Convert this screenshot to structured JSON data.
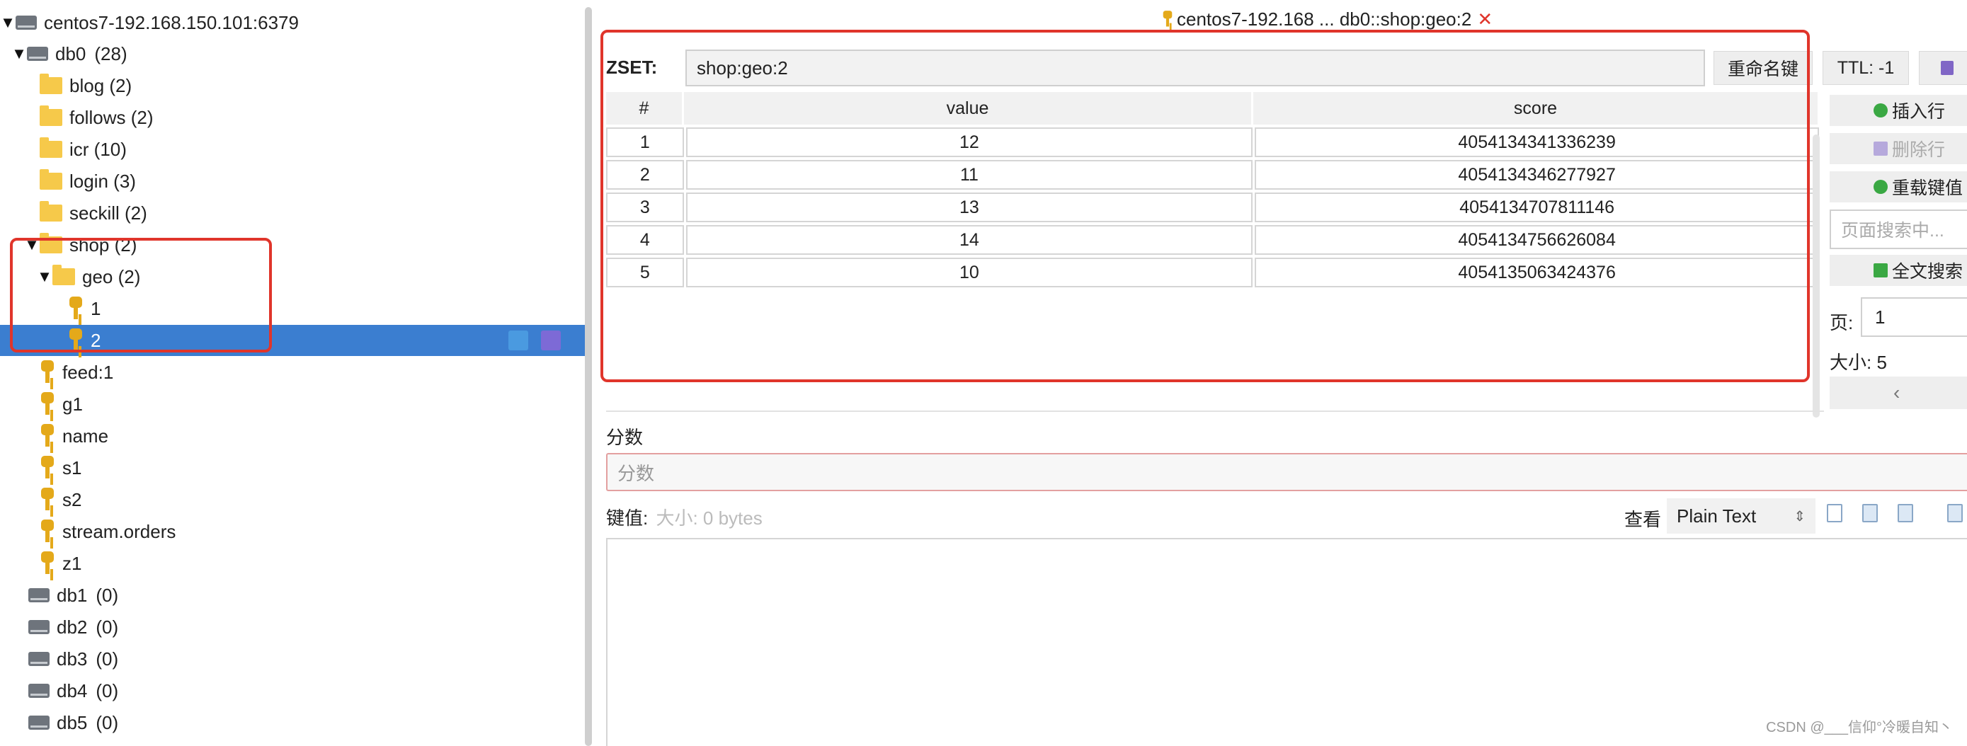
{
  "tree": {
    "connection": "centos7-192.168.150.101:6379",
    "db0": {
      "name": "db0",
      "count": "(28)"
    },
    "folders": [
      {
        "label": "blog (2)"
      },
      {
        "label": "follows (2)"
      },
      {
        "label": "icr (10)"
      },
      {
        "label": "login (3)"
      },
      {
        "label": "seckill (2)"
      },
      {
        "label": "shop (2)"
      }
    ],
    "geo_folder": "geo (2)",
    "geo_keys": [
      "1",
      "2"
    ],
    "keys": [
      "feed:1",
      "g1",
      "name",
      "s1",
      "s2",
      "stream.orders",
      "z1"
    ],
    "dbs": [
      {
        "name": "db1",
        "count": "(0)"
      },
      {
        "name": "db2",
        "count": "(0)"
      },
      {
        "name": "db3",
        "count": "(0)"
      },
      {
        "name": "db4",
        "count": "(0)"
      },
      {
        "name": "db5",
        "count": "(0)"
      }
    ],
    "selected_key": "2"
  },
  "tab": {
    "title": "centos7-192.168 ... db0::shop:geo:2",
    "close": "✕"
  },
  "key_header": {
    "type_label": "ZSET:",
    "key_name": "shop:geo:2",
    "rename_label": "重命名键",
    "ttl_label": "TTL:  -1"
  },
  "table": {
    "headers": [
      "#",
      "value",
      "score"
    ],
    "rows": [
      {
        "num": "1",
        "value": "12",
        "score": "4054134341336239"
      },
      {
        "num": "2",
        "value": "11",
        "score": "4054134346277927"
      },
      {
        "num": "3",
        "value": "13",
        "score": "4054134707811146"
      },
      {
        "num": "4",
        "value": "14",
        "score": "4054134756626084"
      },
      {
        "num": "5",
        "value": "10",
        "score": "4054135063424376"
      }
    ]
  },
  "side": {
    "insert_label": "插入行",
    "delete_label": "删除行",
    "reload_label": "重载键值",
    "search_placeholder": "页面搜索中...",
    "fulltext_label": "全文搜索",
    "page_label": "页:",
    "page_value": "1",
    "size_line": "大小:  5",
    "prev": "‹"
  },
  "editor": {
    "score_title": "分数",
    "score_placeholder": "分数",
    "keyval_label": "键值:",
    "keyval_size": "大小:  0 bytes",
    "view_label": "查看",
    "view_mode": "Plain Text"
  },
  "watermark": "CSDN @___信仰°冷暖自知丶",
  "colors": {
    "selection": "#3b7ed0",
    "highlight_box": "#e0352b",
    "folder": "#f6c94a",
    "key": "#e4a91a"
  }
}
